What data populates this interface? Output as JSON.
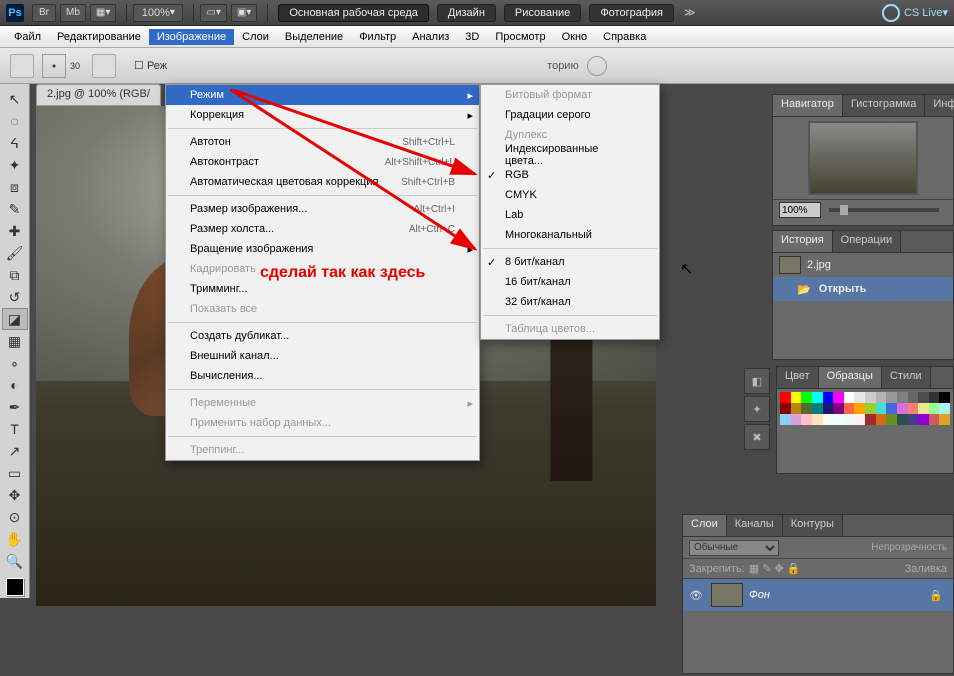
{
  "topbar": {
    "zoom": "100%",
    "workspace_main": "Основная рабочая среда",
    "ws": [
      "Дизайн",
      "Рисование",
      "Фотография"
    ],
    "cs": "CS Live"
  },
  "menu": [
    "Файл",
    "Редактирование",
    "Изображение",
    "Слои",
    "Выделение",
    "Фильтр",
    "Анализ",
    "3D",
    "Просмотр",
    "Окно",
    "Справка"
  ],
  "active_menu": 2,
  "optbar": {
    "num": "30",
    "checkbox": "Реж",
    "history": "торию"
  },
  "doc_tab": "2.jpg @ 100% (RGB/",
  "image_menu": {
    "mode": "Режим",
    "correction": "Коррекция",
    "auto_tone": {
      "l": "Автотон",
      "s": "Shift+Ctrl+L"
    },
    "auto_contrast": {
      "l": "Автоконтраст",
      "s": "Alt+Shift+Ctrl+L"
    },
    "auto_color": {
      "l": "Автоматическая цветовая коррекция",
      "s": "Shift+Ctrl+B"
    },
    "image_size": {
      "l": "Размер изображения...",
      "s": "Alt+Ctrl+I"
    },
    "canvas_size": {
      "l": "Размер холста...",
      "s": "Alt+Ctrl+C"
    },
    "rotation": "Вращение изображения",
    "crop": "Кадрировать",
    "trim": "Тримминг...",
    "reveal": "Показать все",
    "duplicate": "Создать дубликат...",
    "apply_image": "Внешний канал...",
    "calculations": "Вычисления...",
    "variables": "Переменные",
    "apply_dataset": "Применить набор данных...",
    "trapping": "Треппинг..."
  },
  "mode_menu": {
    "bitmap": "Битовый формат",
    "grayscale": "Градации серого",
    "duotone": "Дуплекс",
    "indexed": "Индексированные цвета...",
    "rgb": "RGB",
    "cmyk": "CMYK",
    "lab": "Lab",
    "multichannel": "Многоканальный",
    "b8": "8 бит/канал",
    "b16": "16 бит/канал",
    "b32": "32 бит/канал",
    "color_table": "Таблица цветов..."
  },
  "annotation": "сделай так как здесь",
  "nav": {
    "tabs": [
      "Навигатор",
      "Гистограмма",
      "Инфо"
    ],
    "zoom": "100%"
  },
  "history": {
    "tabs": [
      "История",
      "Операции"
    ],
    "file": "2.jpg",
    "open": "Открыть"
  },
  "color": {
    "tabs": [
      "Цвет",
      "Образцы",
      "Стили"
    ]
  },
  "swatches": [
    "#ff0000",
    "#ffff00",
    "#00ff00",
    "#00ffff",
    "#0000ff",
    "#ff00ff",
    "#ffffff",
    "#e6e6e6",
    "#cccccc",
    "#b3b3b3",
    "#999999",
    "#808080",
    "#666666",
    "#4d4d4d",
    "#333333",
    "#000000",
    "#8b0000",
    "#b8860b",
    "#556b2f",
    "#008080",
    "#191970",
    "#800080",
    "#ff6347",
    "#ffa500",
    "#9acd32",
    "#40e0d0",
    "#4169e1",
    "#da70d6",
    "#fa8072",
    "#f0e68c",
    "#98fb98",
    "#afeeee",
    "#87cefa",
    "#dda0dd",
    "#ffc0cb",
    "#ffe4b5",
    "#f5fffa",
    "#f0ffff",
    "#f0f8ff",
    "#fff0f5",
    "#a52a2a",
    "#d2691e",
    "#6b8e23",
    "#2f4f4f",
    "#483d8b",
    "#9400d3",
    "#cd5c5c",
    "#daa520"
  ],
  "layers": {
    "tabs": [
      "Слои",
      "Каналы",
      "Контуры"
    ],
    "mode": "Обычные",
    "opacity_lbl": "Непрозрачность",
    "lock_lbl": "Закрепить:",
    "fill_lbl": "Заливка",
    "layer_name": "Фон"
  }
}
